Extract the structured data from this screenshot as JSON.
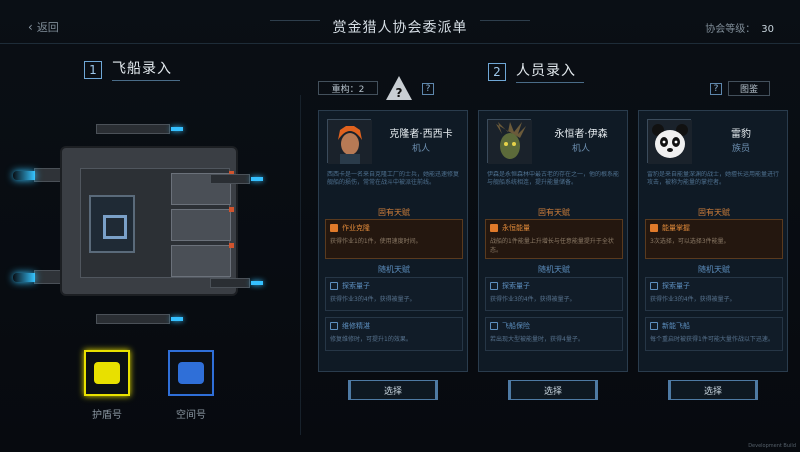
{
  "header": {
    "back_label": "返回",
    "title": "赏金猎人协会委派单",
    "guild_level_label": "协会等级：",
    "guild_level_value": "30"
  },
  "ship_section": {
    "number": "1",
    "label": "飞船录入",
    "choices": [
      {
        "label": "护盾号",
        "color": "#e8e000",
        "selected": true
      },
      {
        "label": "空间号",
        "color": "#2f6fd8",
        "selected": false
      }
    ]
  },
  "crew_section": {
    "number": "2",
    "label": "人员录入",
    "energy_label": "重构：2",
    "warning_symbol": "?",
    "help_symbol": "?",
    "codex_label": "图鉴",
    "fixed_talent_header": "固有天赋",
    "random_talent_header": "随机天赋",
    "select_label": "选择",
    "cards": [
      {
        "name": "克隆者·西西卡",
        "role": "机人",
        "desc": "西西卡是一名来自克隆工厂的士兵，她能迅速修复舰船的损伤，常常在战斗中被派往前线。",
        "fixed_talent": {
          "name": "作业克隆",
          "desc": "获得作业1的1件，使用速度时间。"
        },
        "random_talents": [
          {
            "name": "探索量子",
            "desc": "获得作业3的4件，获得被量子。"
          },
          {
            "name": "维修精湛",
            "desc": "修复维修时，可提升1的效果。"
          }
        ]
      },
      {
        "name": "永恒者·伊森",
        "role": "机人",
        "desc": "伊森是永恒森林中最古老的存在之一，他的根系能与舰船系统相连，提升能量储备。",
        "fixed_talent": {
          "name": "永恒能量",
          "desc": "战船的1件能量上升增长与任意能量提升于全状态。"
        },
        "random_talents": [
          {
            "name": "探索量子",
            "desc": "获得作业3的4件，获得被量子。"
          },
          {
            "name": "飞船保险",
            "desc": "若出现大型被能量时，获得4量子。"
          }
        ]
      },
      {
        "name": "雷豹",
        "role": "族员",
        "desc": "雷豹是来自能量深渊的战士，她擅长运用能量进行攻击，被称为能量的掌控者。",
        "fixed_talent": {
          "name": "能量掌握",
          "desc": "3次选择，可以选择3件能量。"
        },
        "random_talents": [
          {
            "name": "探索量子",
            "desc": "获得作业3的4件，获得被量子。"
          },
          {
            "name": "新能飞船",
            "desc": "每个重启时被获得1件可能大量作战以下迅速。"
          }
        ]
      }
    ]
  },
  "footer": {
    "dev_tag": "Development Build"
  }
}
